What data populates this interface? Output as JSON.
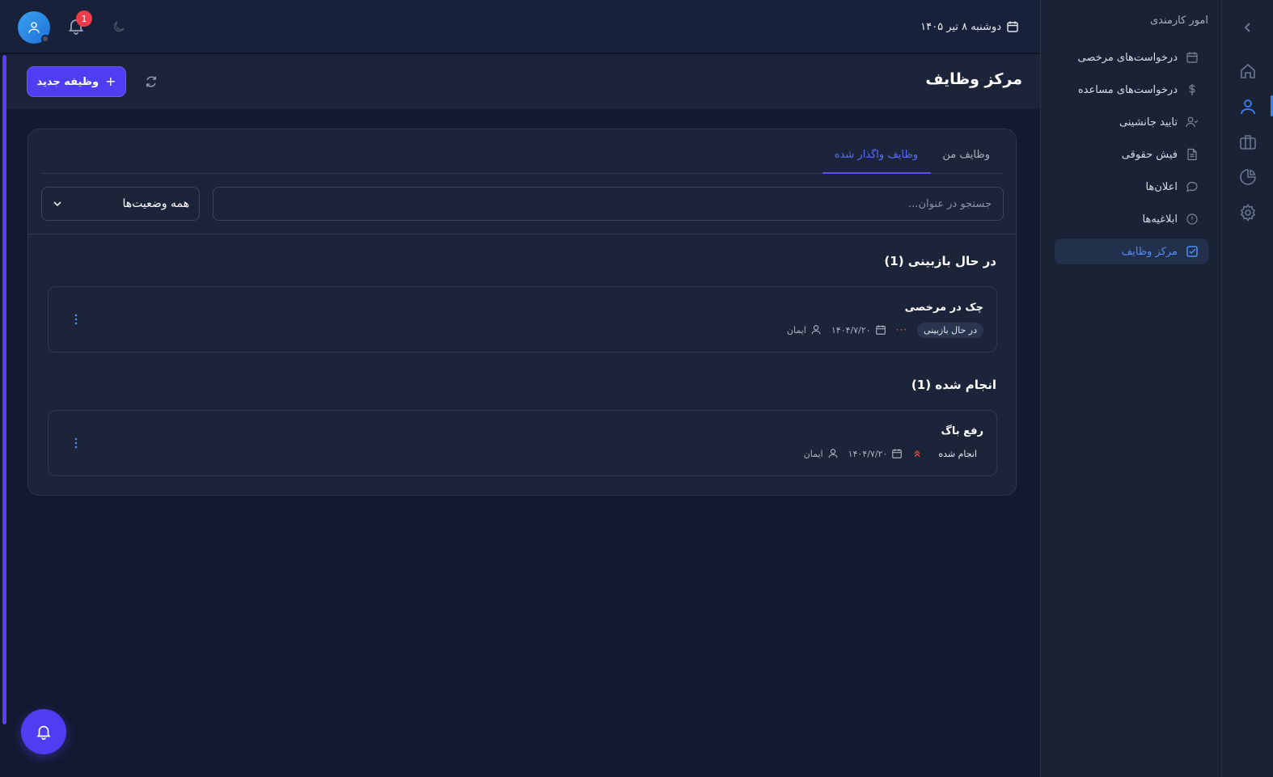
{
  "topbar": {
    "date": "دوشنبه ۸ تیر ۱۴۰۵",
    "notification_count": "1"
  },
  "page": {
    "title": "مرکز وظایف",
    "new_task_label": "وظیفه جدید"
  },
  "sidebar": {
    "section_title": "امور کارمندی",
    "items": [
      {
        "label": "درخواست‌های مرخصی",
        "icon": "calendar-icon"
      },
      {
        "label": "درخواست‌های مساعده",
        "icon": "dollar-icon"
      },
      {
        "label": "تایید جانشینی",
        "icon": "user-check-icon"
      },
      {
        "label": "فیش حقوقی",
        "icon": "file-icon"
      },
      {
        "label": "اعلان‌ها",
        "icon": "chat-icon"
      },
      {
        "label": "ابلاغیه‌ها",
        "icon": "alert-circle-icon"
      },
      {
        "label": "مرکز وظایف",
        "icon": "check-square-icon",
        "active": true
      }
    ]
  },
  "rail": {
    "icons": [
      "chevron-left-icon",
      "home-icon",
      "user-icon",
      "briefcase-icon",
      "pie-chart-icon",
      "gear-icon"
    ]
  },
  "tabs": [
    {
      "label": "وظایف من"
    },
    {
      "label": "وظایف واگذار شده",
      "active": true
    }
  ],
  "filters": {
    "search_placeholder": "جستجو در عنوان...",
    "status_value": "همه وضعیت‌ها"
  },
  "groups": [
    {
      "title": "در حال بازبینی (1)",
      "tasks": [
        {
          "title": "چک در مرخصی",
          "status": "در حال بازبینی",
          "priority": "medium",
          "date": "۱۴۰۴/۷/۲۰",
          "assignee": "ایمان"
        }
      ]
    },
    {
      "title": "انجام شده (1)",
      "tasks": [
        {
          "title": "رفع باگ",
          "status": "انجام شده",
          "priority": "high",
          "date": "۱۴۰۴/۷/۲۰",
          "assignee": "ایمان"
        }
      ]
    }
  ],
  "colors": {
    "accent": "#4f3df2",
    "active_blue": "#4f8ef7",
    "badge_red": "#ef3b4a",
    "background": "#111a2e",
    "panel": "#1b2438"
  }
}
